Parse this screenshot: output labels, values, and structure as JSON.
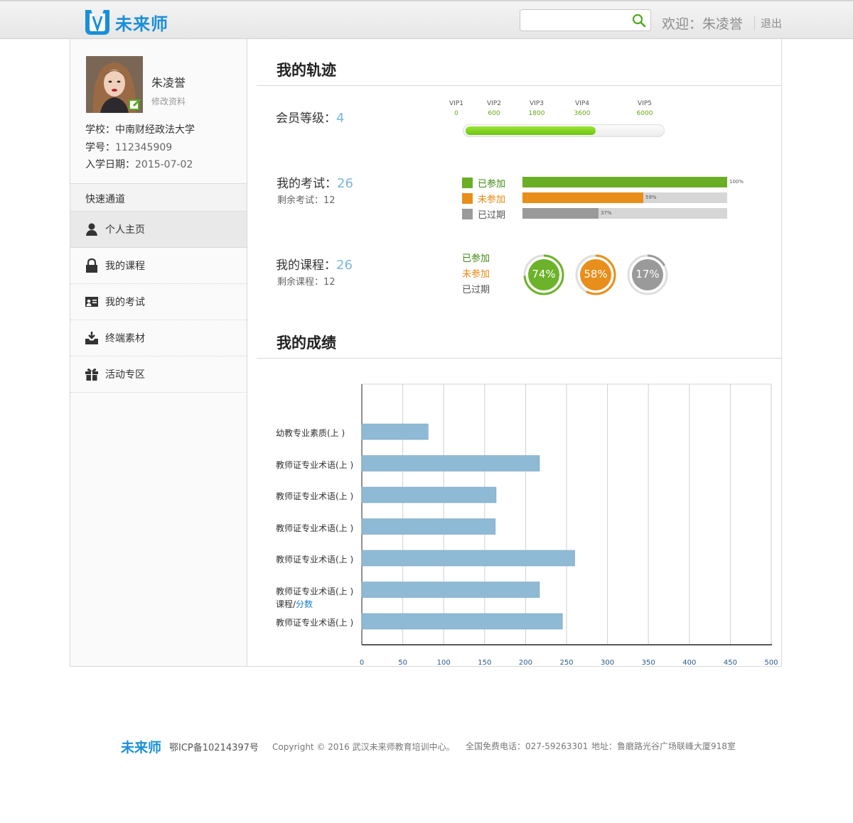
{
  "header": {
    "brand": "未来师",
    "search_placeholder": "",
    "welcome": "欢迎：朱凌誉",
    "logout": "退出"
  },
  "profile": {
    "name": "朱凌誉",
    "edit_label": "修改资料",
    "school_label": "学校：",
    "school": "中南财经政法大学",
    "id_label": "学号：",
    "id": "112345909",
    "enroll_label": "入学日期：",
    "enroll": "2015-07-02"
  },
  "sidebar": {
    "quick_title": "快速通道",
    "items": [
      {
        "label": "个人主页",
        "icon": "user-icon"
      },
      {
        "label": "我的课程",
        "icon": "lock-icon"
      },
      {
        "label": "我的考试",
        "icon": "id-card-icon"
      },
      {
        "label": "终端素材",
        "icon": "download-tray-icon"
      },
      {
        "label": "活动专区",
        "icon": "gift-icon"
      }
    ]
  },
  "track": {
    "title": "我的轨迹",
    "member_label": "会员等级：",
    "member_level": "4",
    "vip_levels": [
      {
        "name": "VIP1",
        "value": "0"
      },
      {
        "name": "VIP2",
        "value": "600"
      },
      {
        "name": "VIP3",
        "value": "1800"
      },
      {
        "name": "VIP4",
        "value": "3600"
      },
      {
        "name": "VIP5",
        "value": "6000"
      }
    ],
    "vip_progress": 0.66,
    "exam_label": "我的考试：",
    "exam_count": "26",
    "exam_remaining": "剩余考试：12",
    "exam_bars": [
      {
        "label": "已参加",
        "pct": 100,
        "pct_text": "100%",
        "color": "#6aae25",
        "text_color": "#3e8a10"
      },
      {
        "label": "未参加",
        "pct": 59,
        "pct_text": "59%",
        "color": "#e88e1a",
        "text_color": "#e8870e"
      },
      {
        "label": "已过期",
        "pct": 37,
        "pct_text": "37%",
        "color": "#9a9a9a",
        "text_color": "#555555"
      }
    ],
    "course_label": "我的课程：",
    "course_count": "26",
    "course_remaining": "剩余课程：12",
    "course_legend": [
      {
        "label": "已参加",
        "color": "#3e8a10"
      },
      {
        "label": "未参加",
        "color": "#e8870e"
      },
      {
        "label": "已过期",
        "color": "#555555"
      }
    ],
    "course_rings": [
      {
        "pct": 74,
        "text": "74%",
        "color": "#6cb22a"
      },
      {
        "pct": 58,
        "text": "58%",
        "color": "#e88e1a"
      },
      {
        "pct": 17,
        "text": "17%",
        "color": "#9a9a9a"
      }
    ]
  },
  "scores": {
    "title": "我的成绩",
    "axis_label_a": "课程/",
    "axis_label_b": "分数"
  },
  "chart_data": {
    "type": "bar",
    "orientation": "horizontal",
    "categories": [
      "幼教专业素质(上 )",
      "教师证专业术语(上 )",
      "教师证专业术语(上 )",
      "教师证专业术语(上 )",
      "教师证专业术语(上 )",
      "教师证专业术语(上 )",
      "教师证专业术语(上 )"
    ],
    "values": [
      81,
      217,
      164,
      163,
      260,
      217,
      245
    ],
    "xlim": [
      0,
      500
    ],
    "xticks": [
      0,
      50,
      100,
      150,
      200,
      250,
      300,
      350,
      400,
      450,
      500
    ],
    "grid": true,
    "bar_color": "#8fbad6"
  },
  "footer": {
    "brand": "未来师",
    "icp": "鄂ICP备10214397号",
    "copyright": "Copyright © 2016 武汉未来师教育培训中心。",
    "tel": "全国免费电话：027-59263301",
    "addr": "地址：鲁磨路光谷广场联峰大厦918室"
  }
}
